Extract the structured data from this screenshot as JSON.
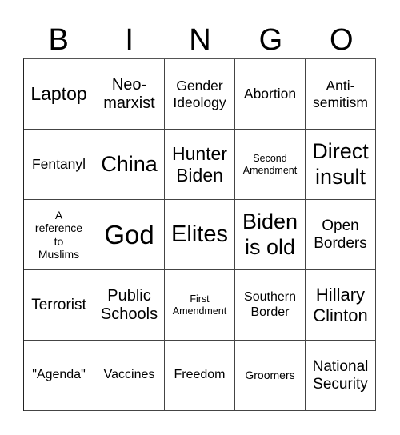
{
  "header": {
    "letters": [
      "B",
      "I",
      "N",
      "G",
      "O"
    ]
  },
  "cells": [
    "Laptop",
    "Neo-\nmarxist",
    "Gender\nIdeology",
    "Abortion",
    "Anti-\nsemitism",
    "Fentanyl",
    "China",
    "Hunter\nBiden",
    "Second\nAmendment",
    "Direct\ninsult",
    "A\nreference\nto\nMuslims",
    "God",
    "Elites",
    "Biden\nis old",
    "Open\nBorders",
    "Terrorist",
    "Public\nSchools",
    "First\nAmendment",
    "Southern\nBorder",
    "Hillary\nClinton",
    "\"Agenda\"",
    "Vaccines",
    "Freedom",
    "Groomers",
    "National\nSecurity"
  ]
}
